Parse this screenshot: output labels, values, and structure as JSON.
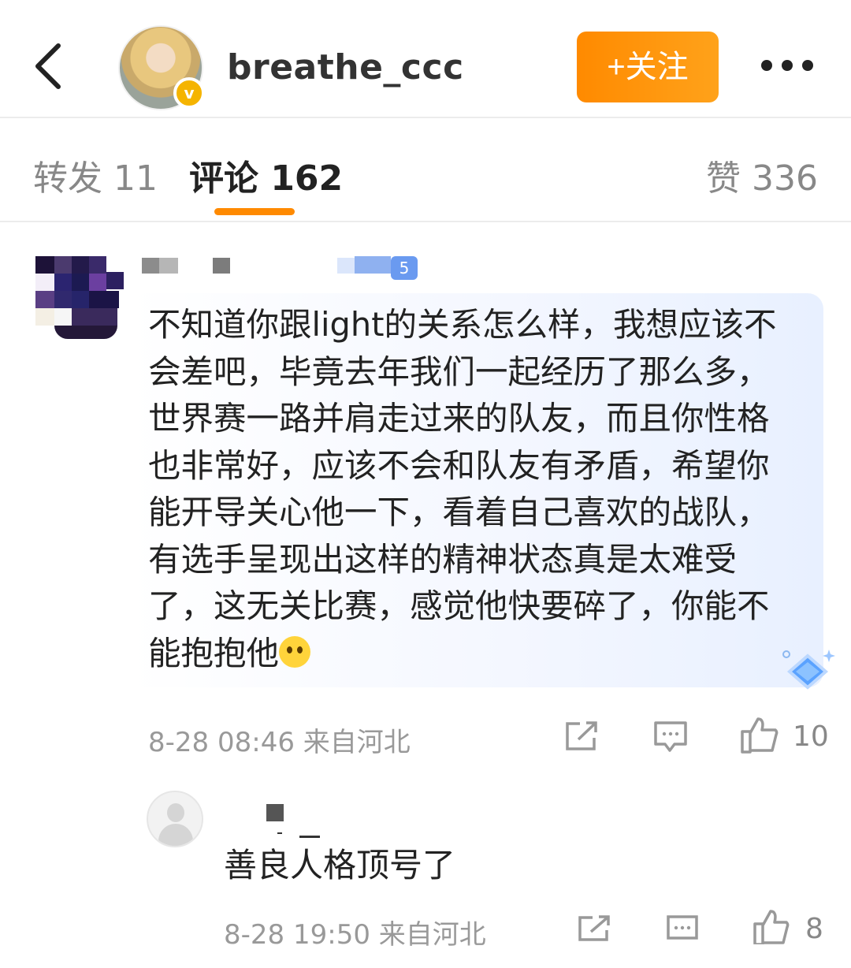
{
  "header": {
    "username": "breathe_ccc",
    "follow_label": "+关注",
    "badge": "v"
  },
  "tabs": {
    "repost": "转发 11",
    "comment": "评论 162",
    "like": "赞 336"
  },
  "comment": {
    "name_suffix": "5",
    "text": "不知道你跟light的关系怎么样，我想应该不会差吧，毕竟去年我们一起经历了那么多，世界赛一路并肩走过来的队友，而且你性格也非常好，应该不会和队友有矛盾，希望你能开导关心他一下，看着自己喜欢的战队，有选手呈现出这样的精神状态真是太难受了，这无关比赛，感觉他快要碎了，你能不能抱抱他",
    "emoji": "pleading-face-icon",
    "meta": "8-28 08:46  来自河北",
    "like_count": "10"
  },
  "reply": {
    "text": "善良人格顶号了",
    "meta": "8-28 19:50  来自河北",
    "like_count": "8"
  },
  "colors": {
    "accent": "#ff8a00",
    "muted": "#999999"
  }
}
